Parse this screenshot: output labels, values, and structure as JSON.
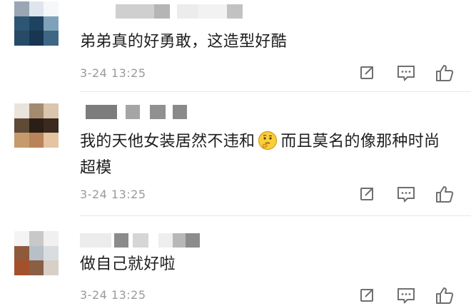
{
  "comments": [
    {
      "text": "弟弟真的好勇敢，这造型好酷",
      "time": "3-24 13:25"
    },
    {
      "text_before": "我的天他女装居然不违和",
      "emoji": "thinking-face-icon",
      "text_after": "而且莫名的像那种时尚超模",
      "time": "3-24 13:25"
    },
    {
      "text": "做自己就好啦",
      "time": "3-24 13:25"
    }
  ],
  "icons": {
    "share": "share-icon",
    "reply": "comment-icon",
    "like": "thumbs-up-icon"
  },
  "colors": {
    "text": "#1e1e1e",
    "meta": "#9a9a9a",
    "icon": "#6f6f6f"
  }
}
